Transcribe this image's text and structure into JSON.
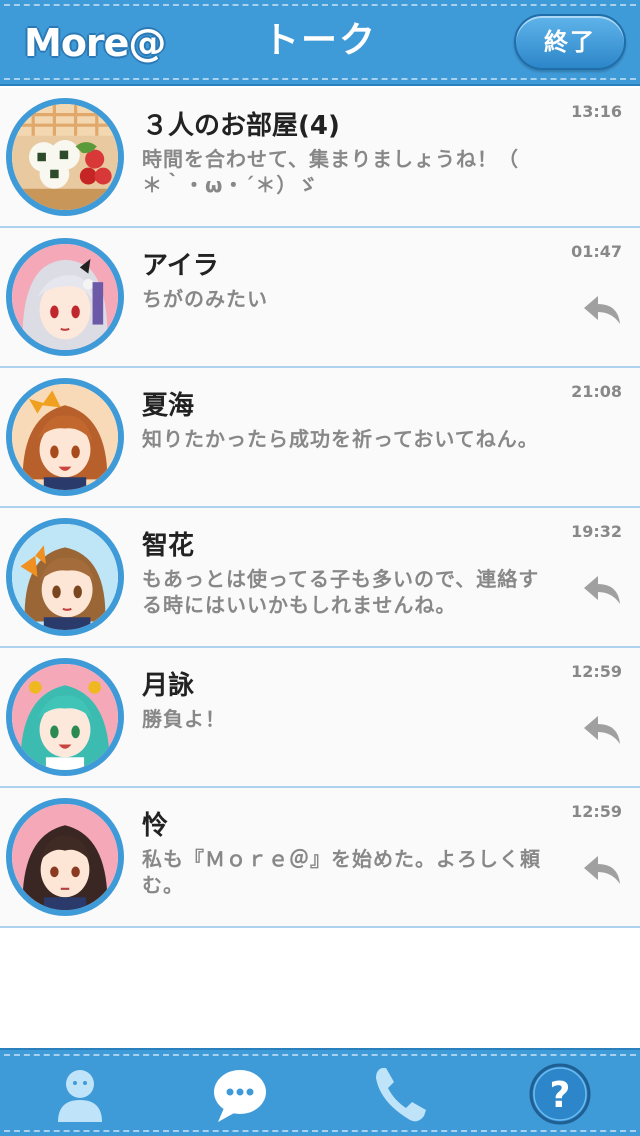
{
  "header": {
    "logo": "More@",
    "title": "トーク",
    "end_button": "終了"
  },
  "threads": [
    {
      "name": "３人のお部屋(4)",
      "message": "時間を合わせて、集まりましょうね！（ ＊｀・ω・´＊）ゞ",
      "time": "13:16",
      "replied": false,
      "avatar_icon": "bento-avatar-icon"
    },
    {
      "name": "アイラ",
      "message": "ちがのみたい",
      "time": "01:47",
      "replied": true,
      "avatar_icon": "aira-avatar-icon"
    },
    {
      "name": "夏海",
      "message": "知りたかったら成功を祈っておいてねん。",
      "time": "21:08",
      "replied": false,
      "avatar_icon": "natsumi-avatar-icon"
    },
    {
      "name": "智花",
      "message": "もあっとは使ってる子も多いので、連絡する時にはいいかもしれませんね。",
      "time": "19:32",
      "replied": true,
      "avatar_icon": "tomoka-avatar-icon"
    },
    {
      "name": "月詠",
      "message": "勝負よ！",
      "time": "12:59",
      "replied": true,
      "avatar_icon": "tsukuyomi-avatar-icon"
    },
    {
      "name": "怜",
      "message": "私も『Ｍｏｒｅ＠』を始めた。よろしく頼む。",
      "time": "12:59",
      "replied": true,
      "avatar_icon": "rei-avatar-icon"
    }
  ],
  "tabbar": {
    "items": [
      "profile-icon",
      "chat-bubble-icon",
      "phone-icon",
      "help-icon"
    ],
    "help_label": "?"
  },
  "colors": {
    "accent": "#3f9ad8",
    "divider": "#aed3ee",
    "message_text": "#888888",
    "name_text": "#222222"
  }
}
